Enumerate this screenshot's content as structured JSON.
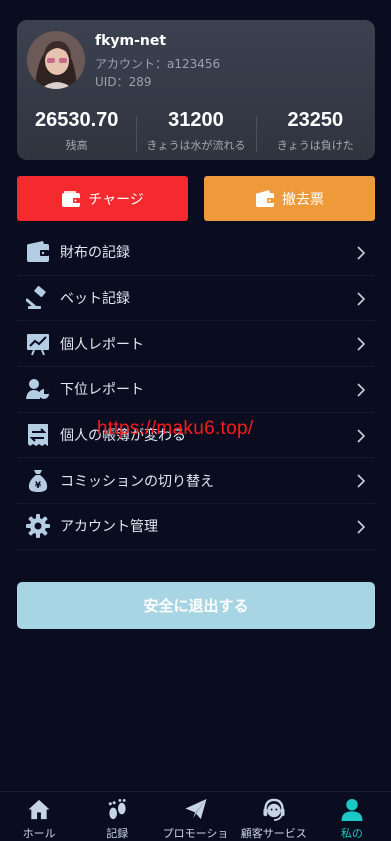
{
  "profile": {
    "username": "fkym-net",
    "account_label": "アカウント：",
    "account_value": "a123456",
    "uid_label": "UID：",
    "uid_value": "289"
  },
  "stats": [
    {
      "value": "26530.70",
      "label": "残高"
    },
    {
      "value": "31200",
      "label": "きょうは水が流れる"
    },
    {
      "value": "23250",
      "label": "きょうは負けた"
    }
  ],
  "actions": {
    "charge_label": "チャージ",
    "withdraw_label": "撤去票"
  },
  "menu": [
    {
      "label": "財布の記録",
      "icon": "wallet-icon"
    },
    {
      "label": "ベット記録",
      "icon": "gavel-icon"
    },
    {
      "label": "個人レポート",
      "icon": "chart-report-icon"
    },
    {
      "label": "下位レポート",
      "icon": "user-chart-icon"
    },
    {
      "label": "個人の帳簿が変わる",
      "icon": "ledger-transfer-icon"
    },
    {
      "label": "コミッションの切り替え",
      "icon": "money-bag-icon"
    },
    {
      "label": "アカウント管理",
      "icon": "gear-icon"
    }
  ],
  "watermark": "https://maku6.top/",
  "logout_label": "安全に退出する",
  "tabs": [
    {
      "label": "ホール",
      "icon": "home-icon"
    },
    {
      "label": "記録",
      "icon": "footprints-icon"
    },
    {
      "label": "プロモーショ",
      "icon": "paper-plane-icon"
    },
    {
      "label": "顧客サービス",
      "icon": "headset-icon"
    },
    {
      "label": "私の",
      "icon": "user-icon",
      "active": true
    }
  ],
  "colors": {
    "background": "#090d1f",
    "charge": "#f42a2e",
    "withdraw": "#ee9a3b",
    "logout": "#a8d5e4",
    "active_tab": "#1bc8c6",
    "menu_icon": "#b5cde2"
  }
}
